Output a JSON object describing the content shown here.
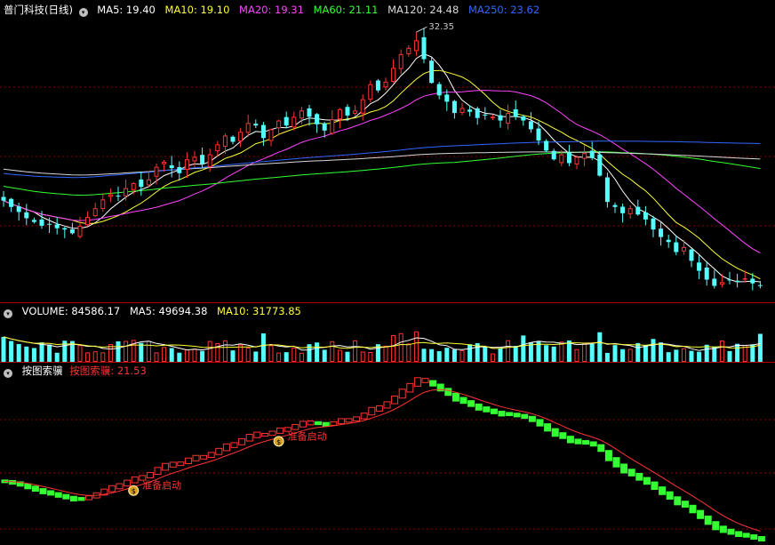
{
  "stock": {
    "name": "普门科技",
    "period": "(日线)"
  },
  "ma_legend": [
    {
      "label": "MA5: 19.40",
      "color": "#ffffff"
    },
    {
      "label": "MA10: 19.10",
      "color": "#ffff33"
    },
    {
      "label": "MA20: 19.31",
      "color": "#ff44ff"
    },
    {
      "label": "MA60: 21.11",
      "color": "#33ff33"
    },
    {
      "label": "MA120: 24.48",
      "color": "#d8d8d8"
    },
    {
      "label": "MA250: 23.62",
      "color": "#3366ff"
    }
  ],
  "price_high_label": "32.35",
  "volume_legend": [
    {
      "label": "VOLUME: 84586.17",
      "color": "#ffffff"
    },
    {
      "label": "MA5: 49694.38",
      "color": "#ffffff"
    },
    {
      "label": "MA10: 31773.85",
      "color": "#ffff33"
    }
  ],
  "indicator": {
    "name": "按图索骥",
    "value_label": "按图索骥: 21.53",
    "signal_label": "准备启动"
  },
  "colors": {
    "up": "#ff3333",
    "down": "#54ffff",
    "ind_up": "#ff3333",
    "ind_down": "#33ff33",
    "grid": "#8b0000",
    "panel_border": "#b00000"
  },
  "chart_data": {
    "type": "candlestick",
    "high": 32.35,
    "closes": [
      18.9,
      18.4,
      18.0,
      17.5,
      17.2,
      16.9,
      17.0,
      16.7,
      16.6,
      16.3,
      16.9,
      17.6,
      18.3,
      19.0,
      19.4,
      19.3,
      19.9,
      20.3,
      20.0,
      20.6,
      21.6,
      22.0,
      21.5,
      21.1,
      22.2,
      22.4,
      21.8,
      22.6,
      23.4,
      24.1,
      23.6,
      24.4,
      25.1,
      24.9,
      23.9,
      24.6,
      25.3,
      24.9,
      25.6,
      26.1,
      25.6,
      25.0,
      24.5,
      25.4,
      26.2,
      25.7,
      26.1,
      27.0,
      28.2,
      27.7,
      28.4,
      29.5,
      30.6,
      31.1,
      31.7,
      30.2,
      28.3,
      27.3,
      26.8,
      25.9,
      26.3,
      26.0,
      25.5,
      25.7,
      25.6,
      25.3,
      25.9,
      25.6,
      25.3,
      24.6,
      23.7,
      22.9,
      22.2,
      22.6,
      21.9,
      22.4,
      22.7,
      22.3,
      20.9,
      18.8,
      18.4,
      17.9,
      18.3,
      17.8,
      17.4,
      16.6,
      16.0,
      15.6,
      14.8,
      15.2,
      14.1,
      13.3,
      12.6,
      12.1,
      12.4,
      12.6,
      12.4,
      12.7,
      12.3,
      12.1
    ],
    "volume": {
      "value": 84586.17,
      "ma5": 49694.38,
      "ma10": 31773.85
    },
    "moving_averages": {
      "MA5": 19.4,
      "MA10": 19.1,
      "MA20": 19.31,
      "MA60": 21.11,
      "MA120": 24.48,
      "MA250": 23.62
    },
    "indicator_value": 21.53
  }
}
